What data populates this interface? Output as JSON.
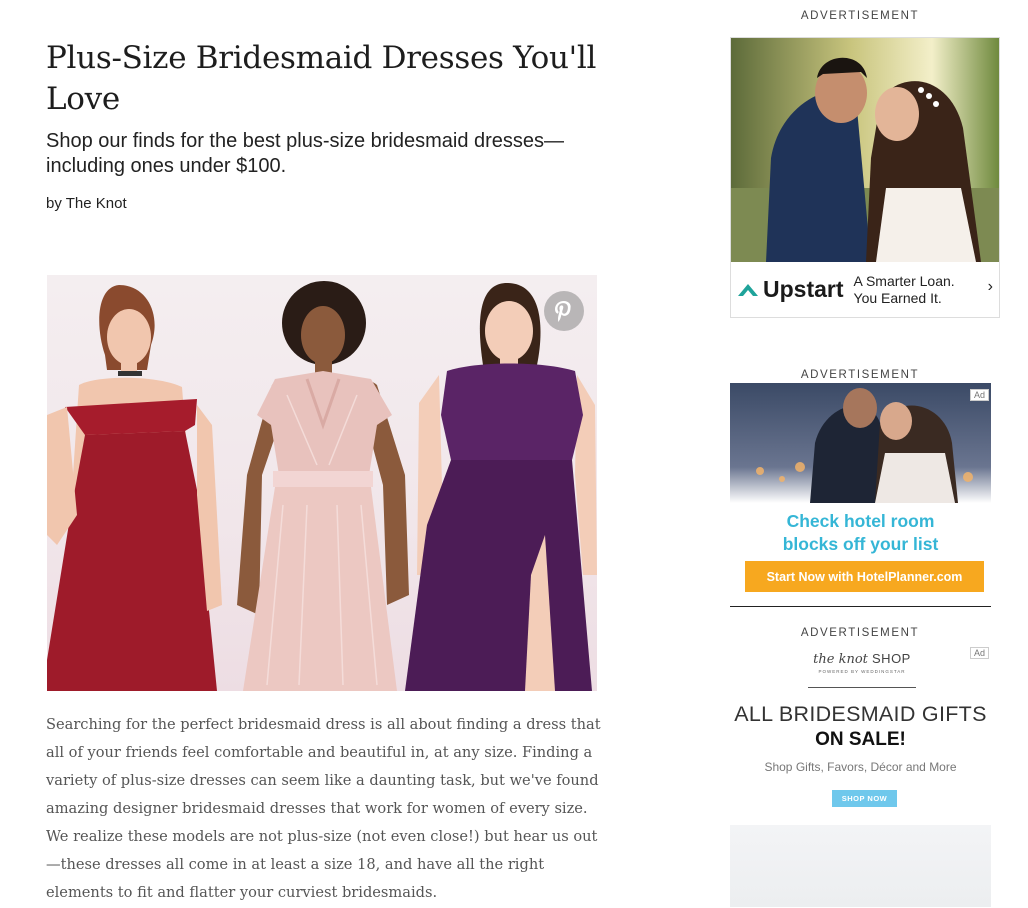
{
  "article": {
    "title": "Plus-Size Bridesmaid Dresses You'll Love",
    "subtitle": "Shop our finds for the best plus-size bridesmaid dresses—including ones under $100.",
    "byline": "by The Knot",
    "body": "Searching for the perfect bridesmaid dress is all about finding a dress that all of your friends feel comfortable and beautiful in, at any size.  Finding a variety of plus-size dresses can seem like a daunting task, but we've found amazing designer bridesmaid dresses that work for women of every size. We realize these models are not plus-size (not even close!) but hear us out—these dresses all come in at least a size 18, and have all the right elements to fit and flatter your curviest bridesmaids."
  },
  "hero": {
    "pin_icon": "pinterest-icon",
    "dress_colors": [
      "#9e1b2a",
      "#e8c2bd",
      "#4c1c56"
    ]
  },
  "ads": {
    "label": "ADVERTISEMENT",
    "badge": "Ad",
    "upstart": {
      "brand": "Upstart",
      "tagline_1": "A Smarter Loan.",
      "tagline_2": "You Earned It.",
      "chevron": "›",
      "logo_color": "#1fa39a"
    },
    "hotelplanner": {
      "headline_1": "Check hotel room",
      "headline_2": "blocks off your list",
      "cta": "Start Now with HotelPlanner.com"
    },
    "knotshop": {
      "logo_1": "the knot",
      "logo_2": "SHOP",
      "logo_sub": "POWERED BY WEDDINGSTAR",
      "headline_1": "ALL BRIDESMAID GIFTS",
      "headline_2": "ON SALE!",
      "sub": "Shop Gifts, Favors, Décor and More",
      "cta": "SHOP NOW"
    }
  }
}
